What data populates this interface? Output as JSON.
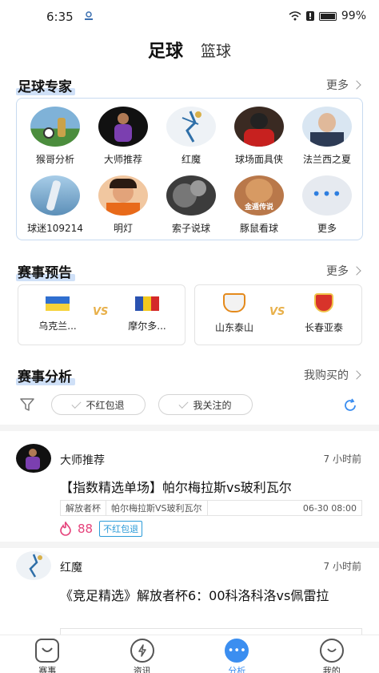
{
  "status_bar": {
    "time": "6:35",
    "battery": "99%"
  },
  "top_tabs": {
    "football": "足球",
    "basketball": "篮球"
  },
  "experts_section": {
    "title": "足球专家",
    "more": "更多",
    "experts": [
      {
        "name": "猴哥分析"
      },
      {
        "name": "大师推荐"
      },
      {
        "name": "红魔"
      },
      {
        "name": "球场面具侠"
      },
      {
        "name": "法兰西之夏"
      },
      {
        "name": "球迷109214"
      },
      {
        "name": "明灯"
      },
      {
        "name": "索子说球"
      },
      {
        "name": "豚鼠看球",
        "overlay": "金遁传说"
      },
      {
        "name": "更多"
      }
    ]
  },
  "matches_section": {
    "title": "赛事预告",
    "more": "更多",
    "vs": "VS",
    "matches": [
      {
        "home": "乌克兰...",
        "away": "摩尔多..."
      },
      {
        "home": "山东泰山",
        "away": "长春亚泰"
      }
    ]
  },
  "analysis_section": {
    "title": "赛事分析",
    "purchased": "我购买的",
    "filters": [
      "不红包退",
      "我关注的"
    ]
  },
  "posts": [
    {
      "author": "大师推荐",
      "time": "7 小时前",
      "title": "【指数精选单场】帕尔梅拉斯vs玻利瓦尔",
      "league": "解放者杯",
      "match": "帕尔梅拉斯VS玻利瓦尔",
      "datetime": "06-30 08:00",
      "price": "88",
      "badge": "不红包退"
    },
    {
      "author": "红魔",
      "time": "7 小时前",
      "title": "《竞足精选》解放者杯6：00科洛科洛vs佩雷拉"
    }
  ],
  "bottom_nav": [
    {
      "label": "赛事"
    },
    {
      "label": "资讯"
    },
    {
      "label": "分析",
      "active": true
    },
    {
      "label": "我的"
    }
  ],
  "colors": {
    "accent": "#3b8ef0",
    "price": "#e5417a",
    "badge": "#2b9bd8",
    "vs": "#e8b04a"
  }
}
